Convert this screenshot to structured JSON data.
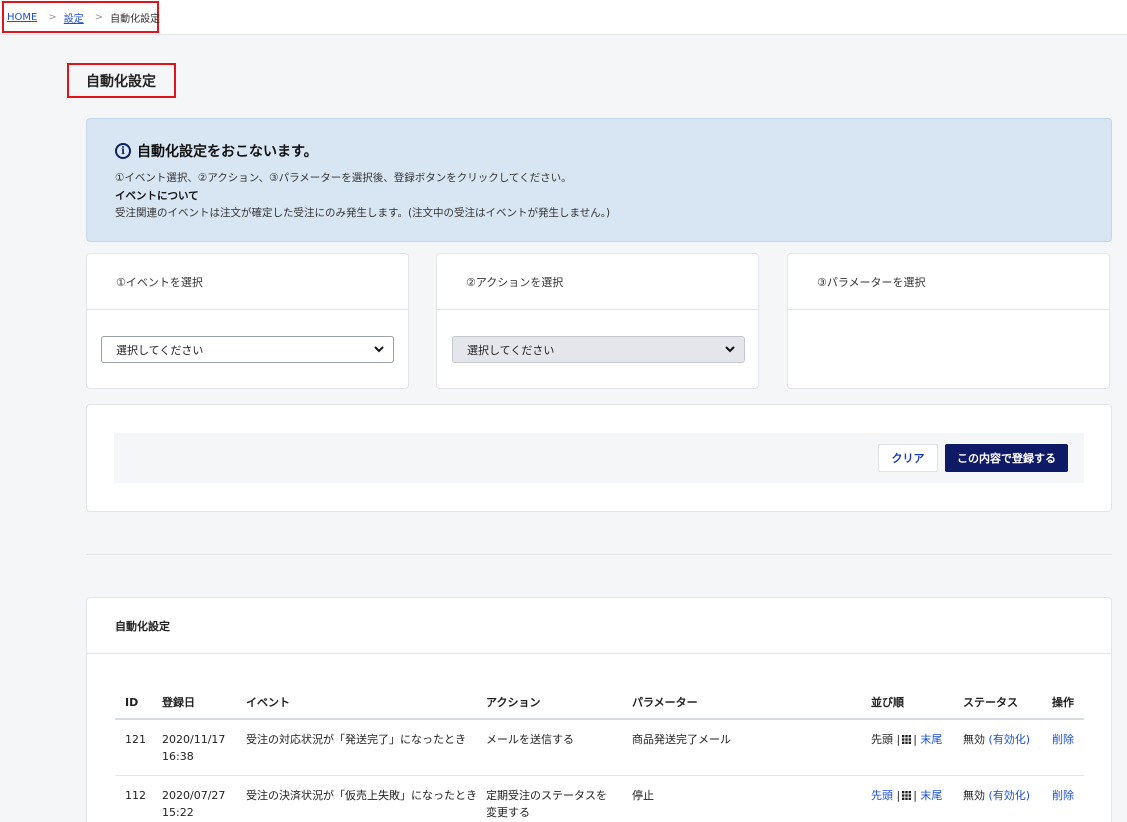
{
  "breadcrumb": {
    "home": "HOME",
    "settings": "設定",
    "current": "自動化設定"
  },
  "page": {
    "title": "自動化設定"
  },
  "info": {
    "heading": "自動化設定をおこないます。",
    "line1": "①イベント選択、②アクション、③パラメーターを選択後、登録ボタンをクリックしてください。",
    "line2": "イベントについて",
    "line3": "受注関連のイベントは注文が確定した受注にのみ発生します。(注文中の受注はイベントが発生しません。)"
  },
  "selectors": {
    "event": {
      "title": "①イベントを選択",
      "value": "選択してください"
    },
    "action": {
      "title": "②アクションを選択",
      "value": "選択してください"
    },
    "parameter": {
      "title": "③パラメーターを選択"
    }
  },
  "buttons": {
    "clear": "クリア",
    "submit": "この内容で登録する"
  },
  "list": {
    "title": "自動化設定",
    "columns": {
      "id": "ID",
      "date": "登録日",
      "event": "イベント",
      "action": "アクション",
      "param": "パラメーター",
      "order": "並び順",
      "status": "ステータス",
      "ops": "操作"
    },
    "rows": [
      {
        "id": "121",
        "date": "2020/11/17",
        "time": "16:38",
        "event": "受注の対応状況が「発送完了」になったとき",
        "action": "メールを送信する",
        "action2": "",
        "param": "商品発送完了メール",
        "first": "先頭",
        "last": "末尾",
        "status": "無効",
        "enable": "(有効化)",
        "delete": "削除"
      },
      {
        "id": "112",
        "date": "2020/07/27",
        "time": "15:22",
        "event": "受注の決済状況が「仮売上失敗」になったとき",
        "action": "定期受注のステータスを",
        "action2": "変更する",
        "param": "停止",
        "first": "先頭",
        "last": "末尾",
        "status": "無効",
        "enable": "(有効化)",
        "delete": "削除"
      }
    ]
  },
  "colors": {
    "accent": "#0e1a66",
    "link": "#1a4fd6",
    "highlight": "#e0141a",
    "info_bg": "#d8e6f4"
  },
  "icons": {
    "info": "info-icon",
    "dropdown": "chevron-down-icon",
    "drag": "grid-icon"
  }
}
